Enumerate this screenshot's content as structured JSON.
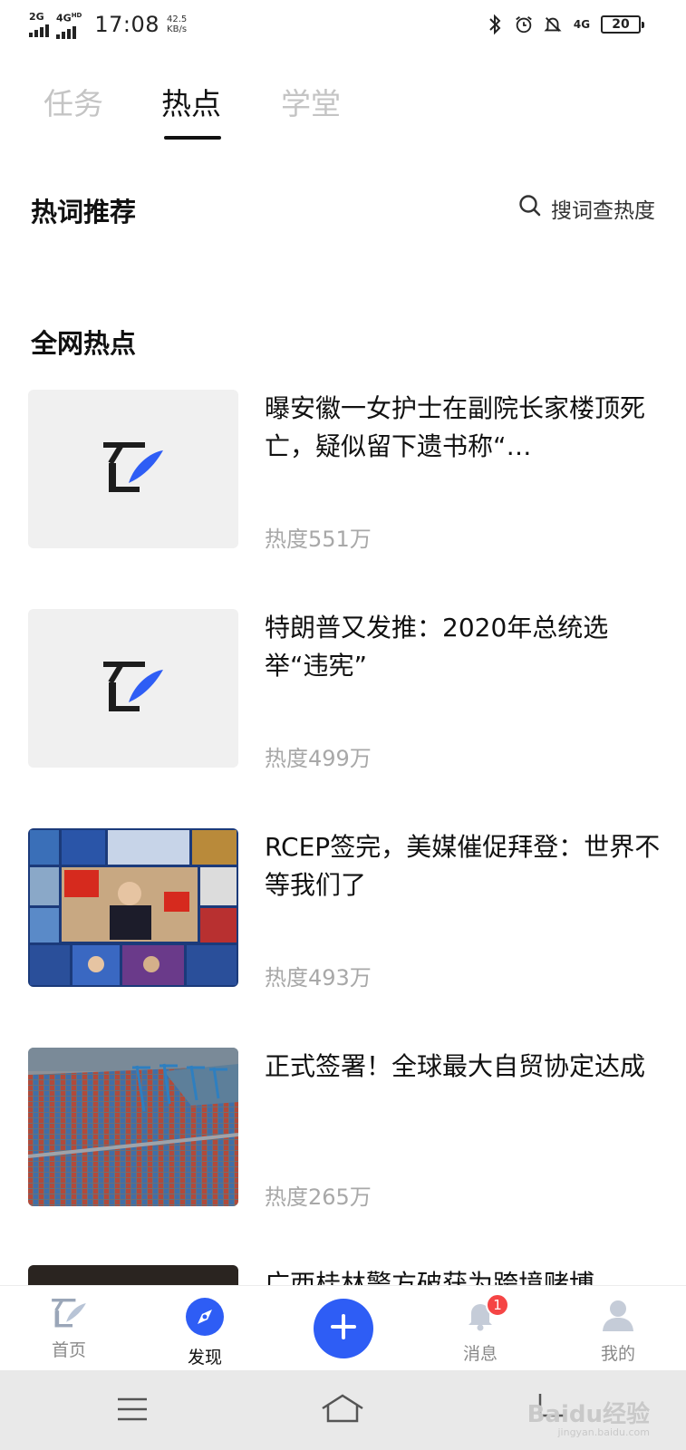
{
  "status_bar": {
    "signal1": "2G",
    "signal2": "4G",
    "signal2_sup": "HD",
    "time": "17:08",
    "speed_value": "42.5",
    "speed_unit": "KB/s",
    "network": "4G",
    "battery": "20"
  },
  "tabs": [
    {
      "label": "任务",
      "active": false
    },
    {
      "label": "热点",
      "active": true
    },
    {
      "label": "学堂",
      "active": false
    }
  ],
  "hot_words": {
    "title": "热词推荐",
    "search_label": "搜词查热度"
  },
  "all_hot": {
    "title": "全网热点"
  },
  "news": [
    {
      "title": "曝安徽一女护士在副院长家楼顶死亡，疑似留下遗书称“…",
      "heat": "热度551万",
      "thumb": "placeholder-logo"
    },
    {
      "title": "特朗普又发推：2020年总统选举“违宪”",
      "heat": "热度499万",
      "thumb": "placeholder-logo"
    },
    {
      "title": "RCEP签完，美媒催促拜登：世界不等我们了",
      "heat": "热度493万",
      "thumb": "video-conference-photo"
    },
    {
      "title": "正式签署！全球最大自贸协定达成",
      "heat": "热度265万",
      "thumb": "container-port-photo"
    },
    {
      "title": "广西桂林警方破获为跨境赌博",
      "heat": "",
      "thumb": "dark-photo"
    }
  ],
  "bottom_nav": {
    "home": "首页",
    "discover": "发现",
    "messages": "消息",
    "messages_badge": "1",
    "mine": "我的"
  },
  "watermark": {
    "text": "Baidu经验",
    "sub": "jingyan.baidu.com"
  },
  "colors": {
    "accent": "#2e5df5",
    "badge": "#f54545",
    "heat_text": "#a8a8a8",
    "inactive_tab": "#c4c4c4"
  }
}
